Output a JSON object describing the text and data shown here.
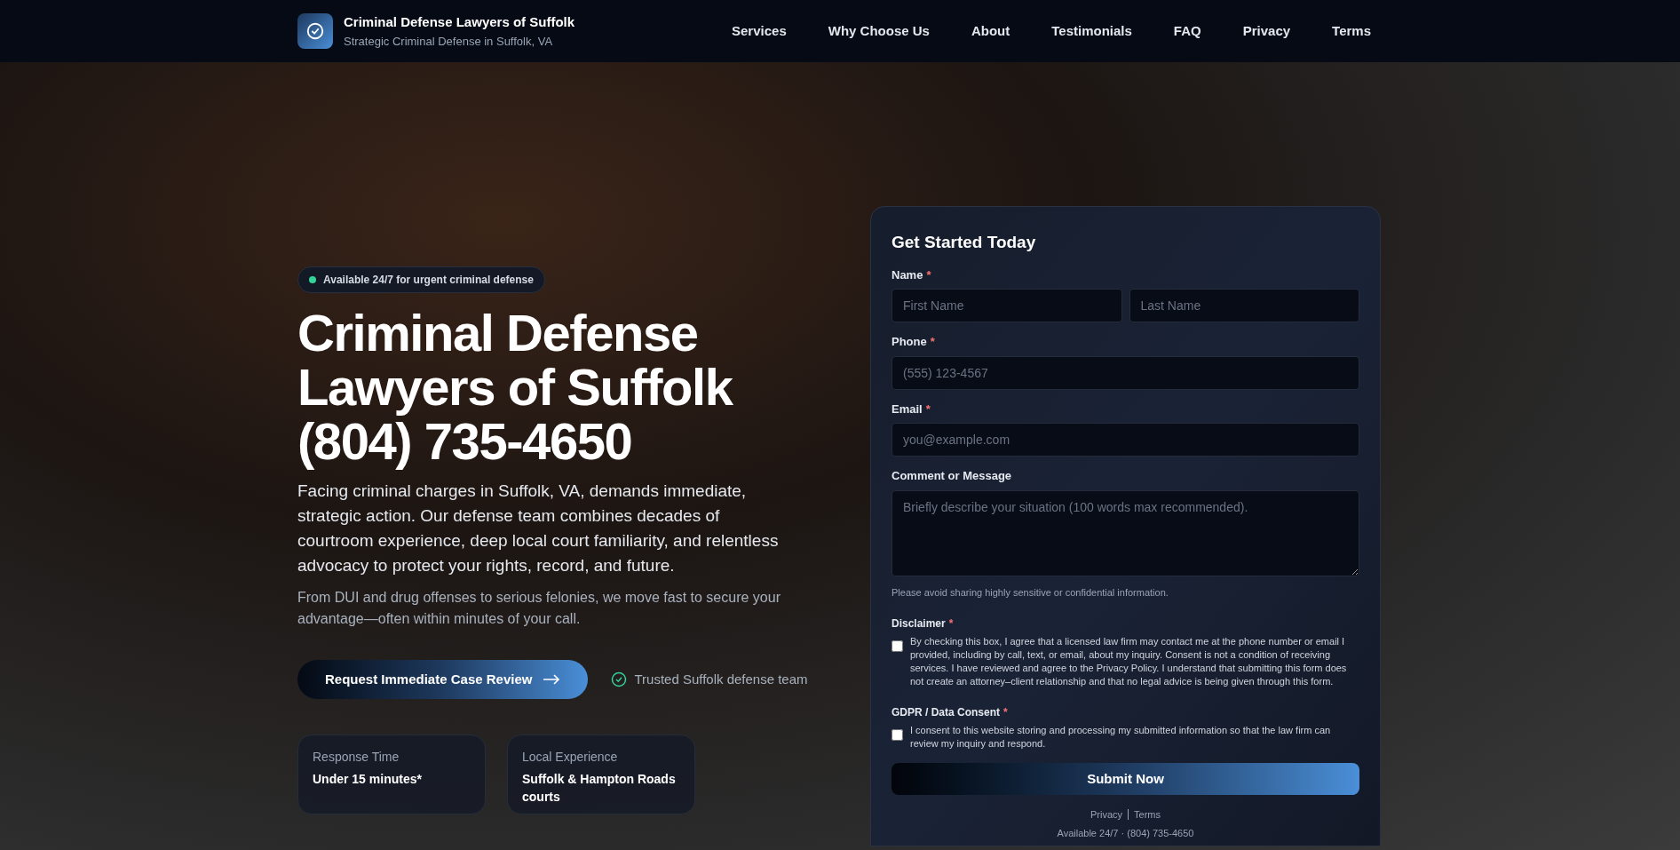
{
  "header": {
    "brand_title": "Criminal Defense Lawyers of Suffolk",
    "brand_subtitle": "Strategic Criminal Defense in Suffolk, VA",
    "nav": [
      "Services",
      "Why Choose Us",
      "About",
      "Testimonials",
      "FAQ",
      "Privacy",
      "Terms"
    ]
  },
  "hero": {
    "badge": "Available 24/7 for urgent criminal defense",
    "headline_lines": [
      "Criminal Defense",
      "Lawyers of Suffolk",
      "(804) 735-4650"
    ],
    "lead": "Facing criminal charges in Suffolk, VA, demands immediate, strategic action. Our defense team combines decades of courtroom experience, deep local court familiarity, and relentless advocacy to protect your rights, record, and future.",
    "sub": "From DUI and drug offenses to serious felonies, we move fast to secure your advantage—often within minutes of your call.",
    "cta": "Request Immediate Case Review",
    "trust": "Trusted Suffolk defense team",
    "stats": [
      {
        "label": "Response Time",
        "value": "Under 15 minutes*"
      },
      {
        "label": "Local Experience",
        "value": "Suffolk & Hampton Roads courts"
      }
    ]
  },
  "form": {
    "title": "Get Started Today",
    "required_mark": "*",
    "fields": [
      {
        "label": "Name",
        "required": true,
        "kind": "input",
        "placeholders": [
          "First Name",
          "Last Name"
        ]
      },
      {
        "label": "Phone",
        "required": true,
        "kind": "input",
        "placeholders": [
          "(555) 123-4567"
        ]
      },
      {
        "label": "Email",
        "required": true,
        "kind": "input",
        "placeholders": [
          "you@example.com"
        ]
      },
      {
        "label": "Comment or Message",
        "required": false,
        "kind": "textarea",
        "placeholders": [
          "Briefly describe your situation (100 words max recommended)."
        ]
      }
    ],
    "hint": "Please avoid sharing highly sensitive or confidential information.",
    "consents": [
      {
        "label": "Disclaimer",
        "required": true,
        "checked": false,
        "text": "By checking this box, I agree that a licensed law firm may contact me at the phone number or email I provided, including by call, text, or email, about my inquiry. Consent is not a condition of receiving services. I have reviewed and agree to the Privacy Policy. I understand that submitting this form does not create an attorney–client relationship and that no legal advice is being given through this form."
      },
      {
        "label": "GDPR / Data Consent",
        "required": true,
        "checked": false,
        "text": "I consent to this website storing and processing my submitted information so that the law firm can review my inquiry and respond."
      }
    ],
    "submit": "Submit Now",
    "links": [
      "Privacy",
      "Terms"
    ],
    "footer_note": "Available 24/7 · (804) 735-4650"
  }
}
